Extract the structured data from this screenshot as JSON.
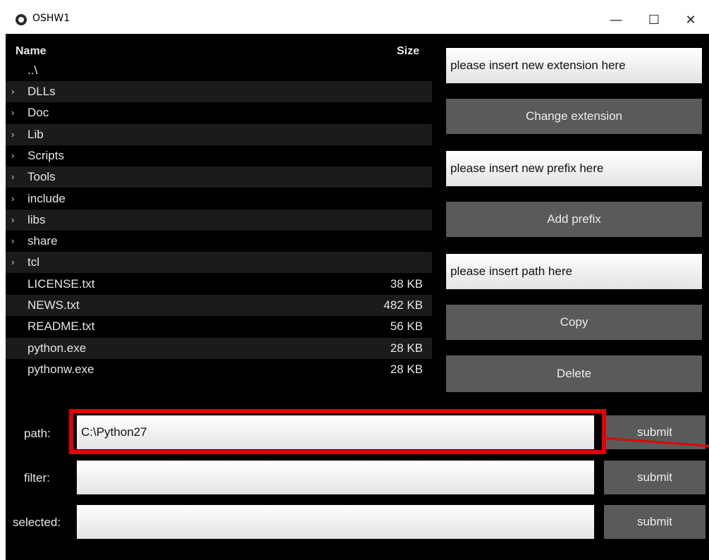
{
  "window": {
    "title": "OSHW1",
    "minimize": "—",
    "maximize": "☐",
    "close": "✕"
  },
  "file_view": {
    "header_name": "Name",
    "header_size": "Size",
    "up_dir": "..\\",
    "rows": [
      {
        "name": "DLLs",
        "size": "",
        "folder": true
      },
      {
        "name": "Doc",
        "size": "",
        "folder": true
      },
      {
        "name": "Lib",
        "size": "",
        "folder": true
      },
      {
        "name": "Scripts",
        "size": "",
        "folder": true
      },
      {
        "name": "Tools",
        "size": "",
        "folder": true
      },
      {
        "name": "include",
        "size": "",
        "folder": true
      },
      {
        "name": "libs",
        "size": "",
        "folder": true
      },
      {
        "name": "share",
        "size": "",
        "folder": true
      },
      {
        "name": "tcl",
        "size": "",
        "folder": true
      },
      {
        "name": "LICENSE.txt",
        "size": "38 KB",
        "folder": false
      },
      {
        "name": "NEWS.txt",
        "size": "482 KB",
        "folder": false
      },
      {
        "name": "README.txt",
        "size": "56 KB",
        "folder": false
      },
      {
        "name": "python.exe",
        "size": "28 KB",
        "folder": false
      },
      {
        "name": "pythonw.exe",
        "size": "28 KB",
        "folder": false
      }
    ],
    "chevron": "›"
  },
  "actions": {
    "extension_input": "please insert new extension here",
    "change_extension": "Change extension",
    "prefix_input": "please insert new prefix here",
    "add_prefix": "Add prefix",
    "path_input": "please insert path here",
    "copy": "Copy",
    "delete": "Delete"
  },
  "form": {
    "path_label": "path:",
    "path_value": "C:\\Python27",
    "filter_label": "filter:",
    "filter_value": "",
    "selected_label": "selected:",
    "selected_value": "",
    "submit": "submit"
  },
  "colors": {
    "highlight": "#e60000",
    "button": "#5a5a5a",
    "background": "#000000"
  }
}
